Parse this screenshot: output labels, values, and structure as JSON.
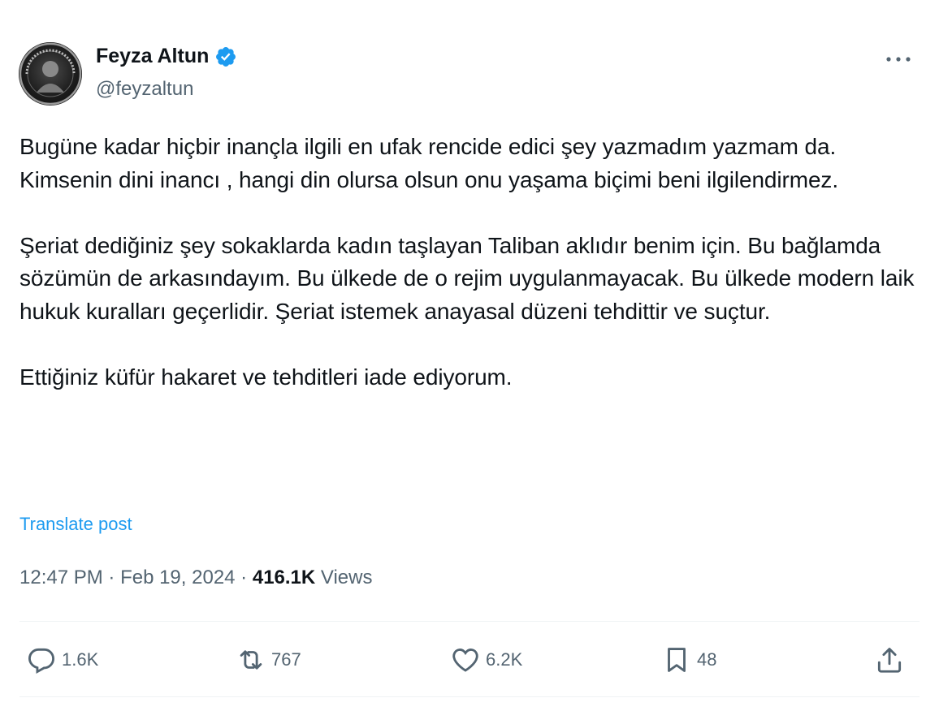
{
  "author": {
    "name": "Feyza Altun",
    "handle": "@feyzaltun",
    "verified_icon": "verified-badge-icon",
    "badge_color": "#1d9bf0"
  },
  "post": {
    "paragraphs": [
      "Bugüne kadar hiçbir inançla ilgili en ufak rencide edici şey yazmadım yazmam da. Kimsenin dini inancı , hangi din olursa olsun onu yaşama biçimi beni ilgilendirmez.",
      "Şeriat dediğiniz şey sokaklarda kadın taşlayan Taliban aklıdır benim için. Bu bağlamda sözümün de arkasındayım. Bu ülkede de o rejim uygulanmayacak. Bu ülkede modern laik hukuk kuralları geçerlidir. Şeriat istemek anayasal düzeni tehdittir ve suçtur.",
      "Ettiğiniz küfür hakaret ve tehditleri iade ediyorum."
    ],
    "translate_label": "Translate post",
    "time": "12:47 PM",
    "separator": " · ",
    "date": "Feb 19, 2024",
    "views_count": "416.1K",
    "views_label": " Views"
  },
  "actions": {
    "replies": "1.6K",
    "reposts": "767",
    "likes": "6.2K",
    "bookmarks": "48"
  },
  "colors": {
    "text": "#0f1419",
    "secondary": "#536471",
    "link": "#1d9bf0",
    "divider": "#eff3f4"
  }
}
